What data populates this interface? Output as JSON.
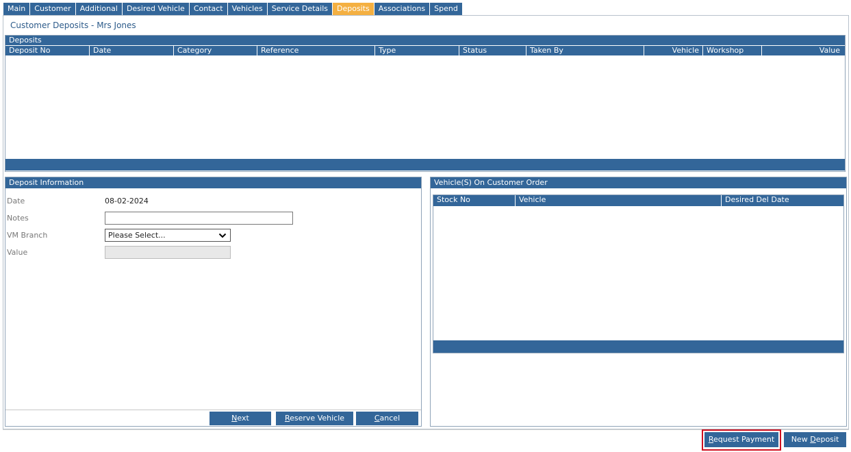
{
  "tabs": [
    {
      "label": "Main",
      "active": false
    },
    {
      "label": "Customer",
      "active": false
    },
    {
      "label": "Additional",
      "active": false
    },
    {
      "label": "Desired Vehicle",
      "active": false
    },
    {
      "label": "Contact",
      "active": false
    },
    {
      "label": "Vehicles",
      "active": false
    },
    {
      "label": "Service Details",
      "active": false
    },
    {
      "label": "Deposits",
      "active": true
    },
    {
      "label": "Associations",
      "active": false
    },
    {
      "label": "Spend",
      "active": false
    }
  ],
  "page_title": "Customer Deposits - Mrs Jones",
  "deposits": {
    "header": "Deposits",
    "columns": [
      "Deposit No",
      "Date",
      "Category",
      "Reference",
      "Type",
      "Status",
      "Taken By",
      "Vehicle",
      "Workshop",
      "Value"
    ]
  },
  "deposit_info": {
    "header": "Deposit Information",
    "date_label": "Date",
    "date_value": "08-02-2024",
    "notes_label": "Notes",
    "notes_value": "",
    "branch_label": "VM Branch",
    "branch_selected": "Please Select...",
    "value_label": "Value",
    "buttons": {
      "next_key": "N",
      "next_rest": "ext",
      "reserve_key": "R",
      "reserve_rest": "eserve Vehicle",
      "cancel_key": "C",
      "cancel_rest": "ancel"
    }
  },
  "vehicles_on_order": {
    "header": "Vehicle(S) On Customer Order",
    "columns": [
      "Stock No",
      "Vehicle",
      "Desired Del Date"
    ]
  },
  "footer_buttons": {
    "request_key": "R",
    "request_rest": "equest Payment",
    "new_prefix": "New ",
    "new_key": "D",
    "new_rest": "eposit"
  },
  "colors": {
    "header_blue": "#336699",
    "active_tab": "#f4b042",
    "highlight_red": "#d01020"
  }
}
